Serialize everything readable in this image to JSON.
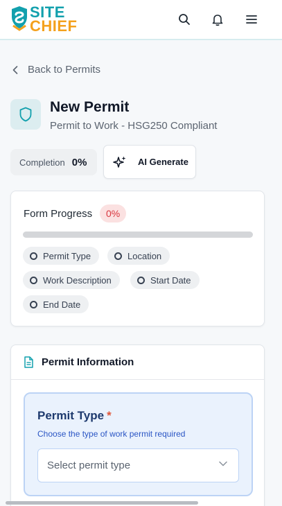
{
  "brand": {
    "line1": "SITE",
    "line2": "CHIEF",
    "primary_color": "#12a0ad",
    "accent_color": "#f4a11d"
  },
  "header_icons": [
    "search-icon",
    "bell-icon",
    "menu-icon"
  ],
  "back_link": {
    "label": "Back to Permits"
  },
  "page": {
    "title": "New Permit",
    "subtitle": "Permit to Work - HSG250 Compliant",
    "icon": "shield-icon"
  },
  "completion": {
    "label": "Completion",
    "value": "0%"
  },
  "ai_generate": {
    "label": "AI Generate",
    "icon": "sparkle-icon"
  },
  "form_progress": {
    "title": "Form Progress",
    "badge": "0%",
    "progress_fraction": 0,
    "steps": [
      {
        "label": "Permit Type"
      },
      {
        "label": "Location"
      },
      {
        "label": "Work Description"
      },
      {
        "label": "Start Date"
      },
      {
        "label": "End Date"
      }
    ]
  },
  "permit_info": {
    "title": "Permit Information",
    "field": {
      "label": "Permit Type",
      "required_mark": "*",
      "help": "Choose the type of work permit required",
      "placeholder": "Select permit type"
    }
  }
}
